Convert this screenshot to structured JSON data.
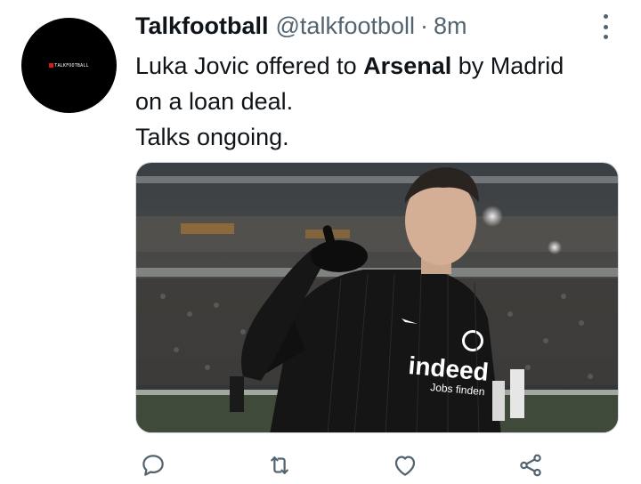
{
  "tweet": {
    "author_name": "Talkfootball",
    "handle": "@talkfootboll",
    "separator": "·",
    "time": "8m",
    "avatar_text": "TALKFOOTBALL",
    "text_line1_pre": "Luka Jovic offered to ",
    "text_line1_bold": "Arsenal",
    "text_line1_post": " by Madrid",
    "text_line2": "on a loan deal.",
    "text_line3": "Talks ongoing."
  },
  "media": {
    "jersey_sponsor": "indeed",
    "jersey_sub": "Jobs finden"
  },
  "actions": [
    {
      "name": "reply",
      "icon": "reply-icon"
    },
    {
      "name": "retweet",
      "icon": "retweet-icon"
    },
    {
      "name": "like",
      "icon": "like-icon"
    },
    {
      "name": "share",
      "icon": "share-icon"
    }
  ],
  "colors": {
    "text": "#0f1419",
    "secondary": "#536471",
    "icon": "#536471"
  }
}
